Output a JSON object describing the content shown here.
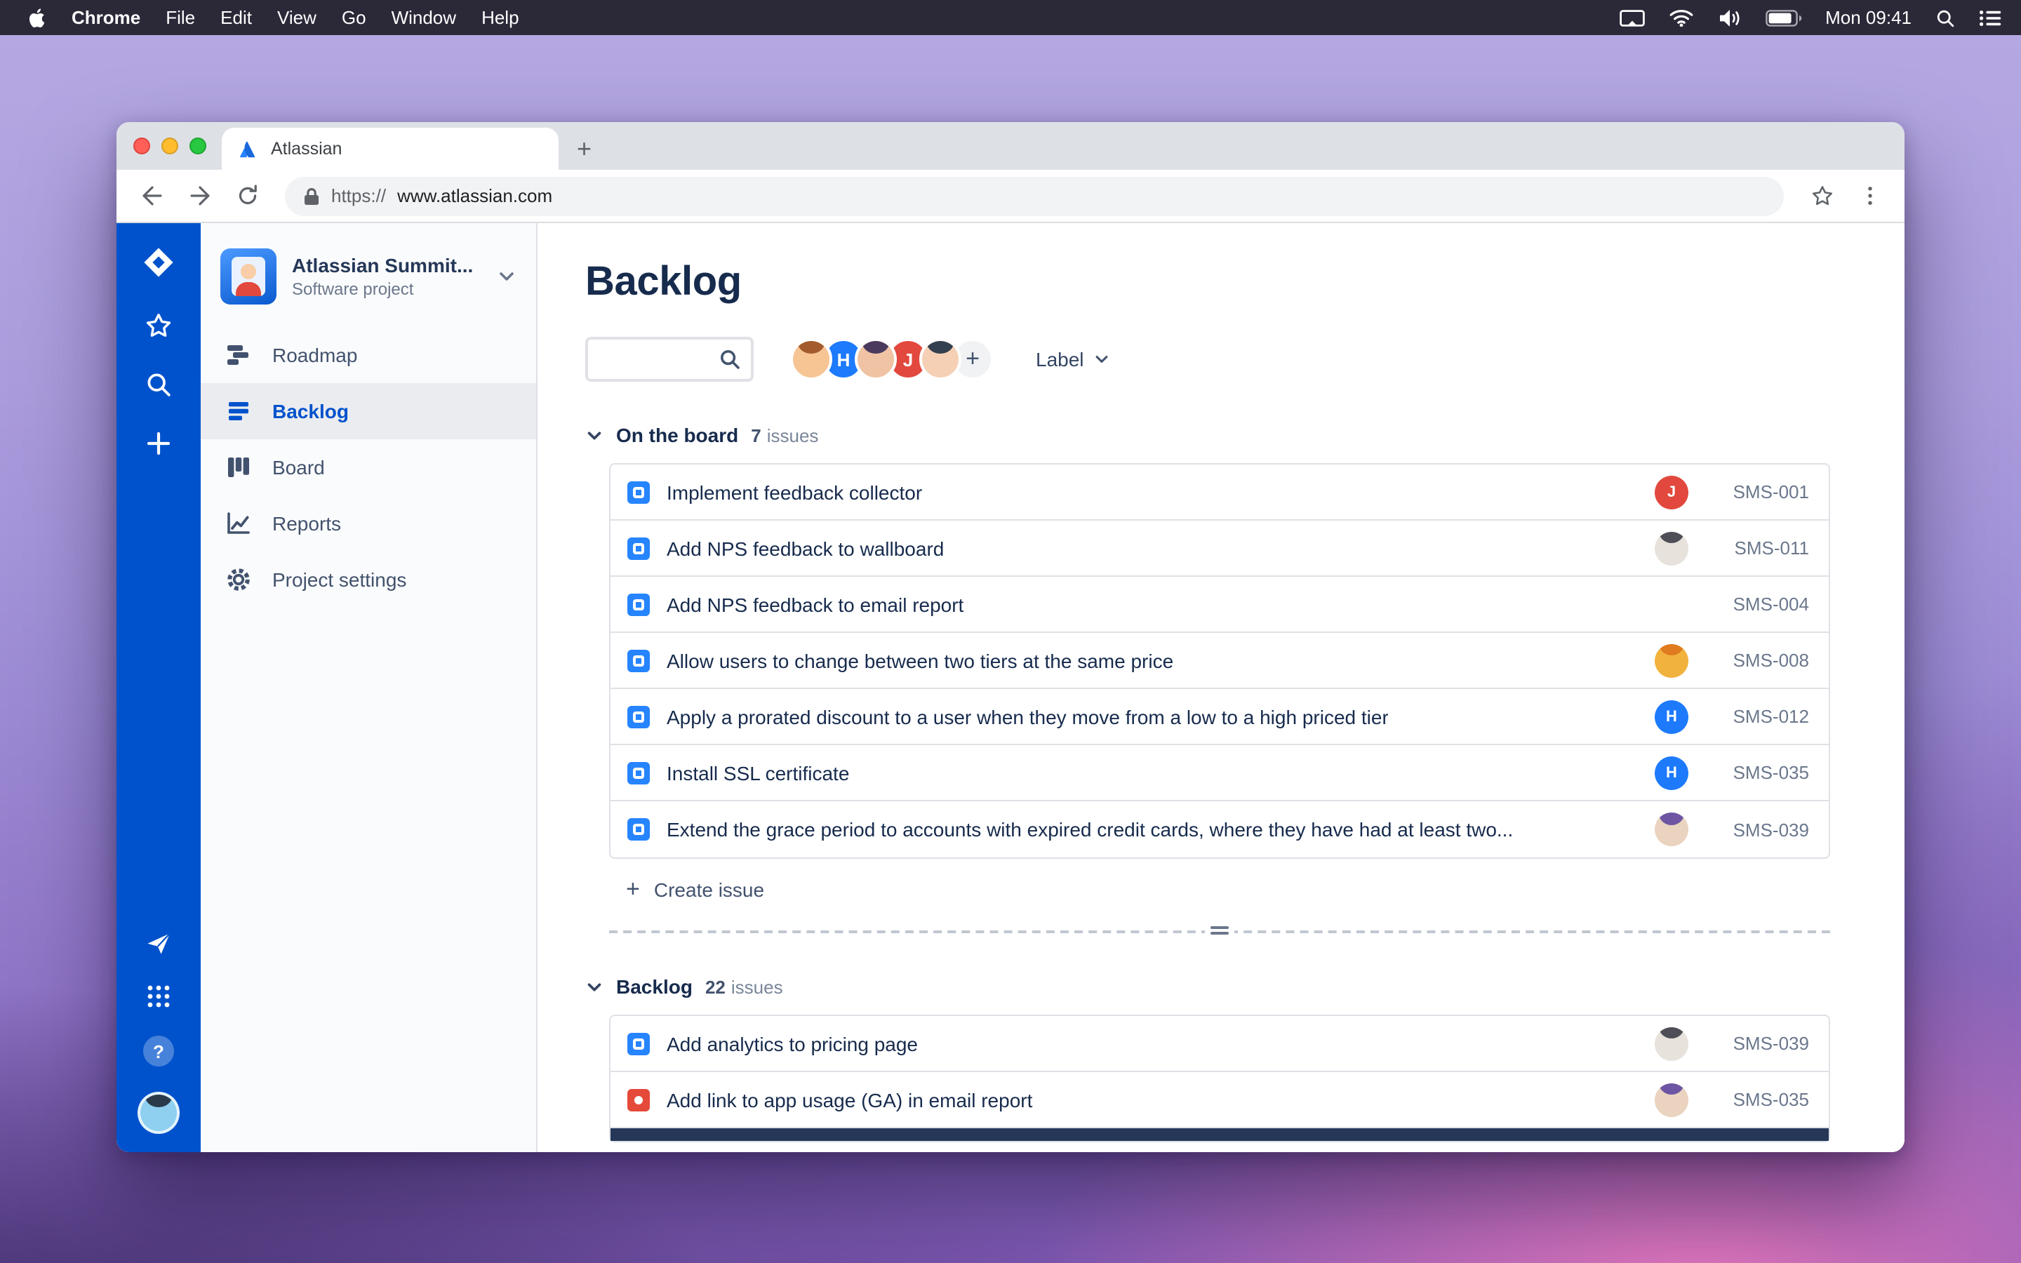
{
  "menubar": {
    "apps": [
      "Chrome",
      "File",
      "Edit",
      "View",
      "Go",
      "Window",
      "Help"
    ],
    "clock": "Mon 09:41"
  },
  "browser": {
    "tab": "Atlassian",
    "scheme": "https://",
    "url": "www.atlassian.com"
  },
  "project": {
    "name": "Atlassian Summit...",
    "type": "Software project"
  },
  "nav": {
    "items": [
      {
        "label": "Roadmap"
      },
      {
        "label": "Backlog"
      },
      {
        "label": "Board"
      },
      {
        "label": "Reports"
      },
      {
        "label": "Project settings"
      }
    ]
  },
  "main": {
    "title": "Backlog",
    "label_filter": "Label",
    "create_issue": "Create issue",
    "sections": [
      {
        "title": "On the board",
        "count": "7",
        "unit": "issues"
      },
      {
        "title": "Backlog",
        "count": "22",
        "unit": "issues"
      }
    ]
  },
  "colors": {
    "accent": "#0052CC",
    "story_icon": "#2684FF",
    "bug_icon": "#E5493A",
    "sidebar": "#0052CC"
  },
  "header_avatars": [
    {
      "style": "--skin:#F7C493;--hair:#A35B2D"
    },
    {
      "text": "H",
      "style": "background:#1D7AFC"
    },
    {
      "style": "--skin:#EFC3A3;--hair:#4A3A5E"
    },
    {
      "text": "J",
      "style": "background:#E2483D"
    },
    {
      "style": "--skin:#F5D0B5;--hair:#33404F"
    },
    {
      "text": "+"
    }
  ],
  "board_issues": [
    {
      "title": "Implement feedback collector",
      "key": "SMS-001",
      "avatar": {
        "kind": "initial",
        "text": "J",
        "style": "background:#E2483D"
      }
    },
    {
      "title": "Add NPS feedback to wallboard",
      "key": "SMS-011",
      "avatar": {
        "kind": "face",
        "style": "--skin:#E7E2DB;--hair:#4E4E57"
      }
    },
    {
      "title": "Add NPS feedback to email report",
      "key": "SMS-004",
      "avatar": {
        "kind": "none"
      }
    },
    {
      "title": "Allow users to change between two tiers at the same price",
      "key": "SMS-008",
      "avatar": {
        "kind": "face",
        "style": "--skin:#F2B23E;--hair:#E07B1F"
      }
    },
    {
      "title": "Apply a prorated discount to a user when they move from a low to a high priced tier",
      "key": "SMS-012",
      "avatar": {
        "kind": "initial",
        "text": "H",
        "style": "background:#1D7AFC"
      }
    },
    {
      "title": "Install SSL certificate",
      "key": "SMS-035",
      "avatar": {
        "kind": "initial",
        "text": "H",
        "style": "background:#1D7AFC"
      }
    },
    {
      "title": "Extend the grace period to accounts with expired credit cards, where they have had at least two...",
      "key": "SMS-039",
      "avatar": {
        "kind": "face",
        "style": "--skin:#EAD3BF;--hair:#6D55A3"
      }
    }
  ],
  "backlog_issues": [
    {
      "title": "Add analytics to pricing page",
      "key": "SMS-039",
      "avatar": {
        "kind": "face",
        "style": "--skin:#E7E2DB;--hair:#4E4E57"
      }
    },
    {
      "title": "Add link to app usage (GA) in email report",
      "key": "SMS-035",
      "avatar": {
        "kind": "face",
        "style": "--skin:#EAD3BF;--hair:#6D55A3"
      }
    }
  ]
}
